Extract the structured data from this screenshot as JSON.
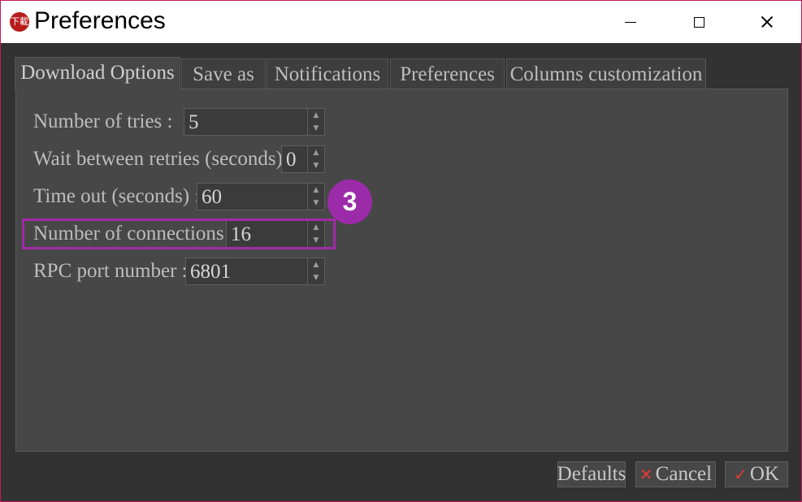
{
  "window": {
    "title": "Preferences",
    "app_icon_text": "下載",
    "controls": {
      "minimize": "minimize-icon",
      "maximize": "maximize-icon",
      "close": "close-icon"
    }
  },
  "tabs": [
    {
      "label": "Download Options",
      "active": true
    },
    {
      "label": "Save as",
      "active": false
    },
    {
      "label": "Notifications",
      "active": false
    },
    {
      "label": "Preferences",
      "active": false
    },
    {
      "label": "Columns customization",
      "active": false
    }
  ],
  "fields": {
    "tries": {
      "label": "Number of tries :",
      "value": "5"
    },
    "wait": {
      "label": "Wait between retries (seconds) :",
      "value": "0"
    },
    "timeout": {
      "label": "Time out (seconds) :",
      "value": "60"
    },
    "connections": {
      "label": "Number of connections :",
      "value": "16"
    },
    "rpc_port": {
      "label": "RPC port number :",
      "value": "6801"
    }
  },
  "annotation": {
    "step": "3",
    "color": "#9b2ba8"
  },
  "buttons": {
    "defaults": "Defaults",
    "cancel": "Cancel",
    "ok": "OK"
  },
  "icons": {
    "up": "▲",
    "down": "▼",
    "cancel": "✕",
    "ok": "✓"
  },
  "colors": {
    "background": "#323232",
    "panel": "#474747",
    "accent_red": "#e53935",
    "highlight": "#a12aa8"
  }
}
